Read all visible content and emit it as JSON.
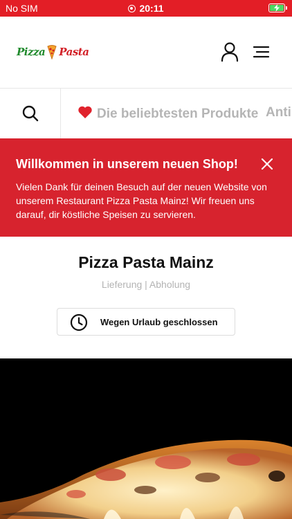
{
  "status_bar": {
    "carrier": "No SIM",
    "time": "20:11"
  },
  "header": {
    "logo_word_1": "Pizza",
    "logo_word_2": "Pasta"
  },
  "categories": [
    {
      "label": "Die beliebtesten Produkte",
      "icon": "heart-icon"
    },
    {
      "label": "Antipasti"
    }
  ],
  "banner": {
    "title": "Willkommen in unserem neuen Shop!",
    "text": "Vielen Dank für deinen Besuch auf der neuen Website von unserem Restaurant Pizza Pasta Mainz! Wir freuen uns darauf, dir köstliche Speisen zu servieren."
  },
  "store": {
    "name": "Pizza Pasta Mainz",
    "modes": "Lieferung | Abholung",
    "status": "Wegen Urlaub geschlossen"
  },
  "colors": {
    "brand_red": "#d7232e",
    "status_red": "#e31e26",
    "muted": "#b5b5b5"
  }
}
